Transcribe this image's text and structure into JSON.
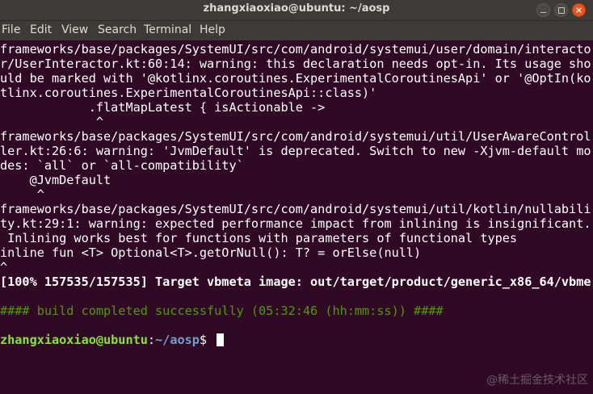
{
  "window": {
    "title": "zhangxiaoxiao@ubuntu: ~/aosp",
    "minimize_glyph": "",
    "maximize_glyph": "",
    "close_glyph": "×"
  },
  "menu": [
    "File",
    "Edit",
    "View",
    "Search",
    "Terminal",
    "Help"
  ],
  "terminal": {
    "lines": [
      "frameworks/base/packages/SystemUI/src/com/android/systemui/user/domain/interacto",
      "r/UserInteractor.kt:60:14: warning: this declaration needs opt-in. Its usage sho",
      "uld be marked with '@kotlinx.coroutines.ExperimentalCoroutinesApi' or '@OptIn(ko",
      "tlinx.coroutines.ExperimentalCoroutinesApi::class)'",
      "            .flatMapLatest { isActionable ->",
      "             ^",
      "frameworks/base/packages/SystemUI/src/com/android/systemui/util/UserAwareControl",
      "ler.kt:26:6: warning: 'JvmDefault' is deprecated. Switch to new -Xjvm-default mo",
      "des: `all` or `all-compatibility`",
      "    @JvmDefault",
      "     ^",
      "frameworks/base/packages/SystemUI/src/com/android/systemui/util/kotlin/nullabili",
      "ty.kt:29:1: warning: expected performance impact from inlining is insignificant.",
      " Inlining works best for functions with parameters of functional types",
      "inline fun <T> Optional<T>.getOrNull(): T? = orElse(null)",
      "^"
    ],
    "status_line": "[100% 157535/157535] Target vbmeta image: out/target/product/generic_x86_64/vbme",
    "build_result": "#### build completed successfully (05:32:46 (hh:mm:ss)) ####",
    "prompt_user": "zhangxiaoxiao@ubuntu",
    "prompt_sep": ":",
    "prompt_path": "~/aosp",
    "prompt_symbol": "$ "
  },
  "watermark": "@稀土掘金技术社区",
  "colors": {
    "terminal_bg": "#300a24",
    "titlebar_bg": "#3c3b37",
    "close_button": "#e95420",
    "prompt_user": "#8ae234",
    "prompt_path": "#729fcf",
    "success_text": "#4e9a06"
  }
}
